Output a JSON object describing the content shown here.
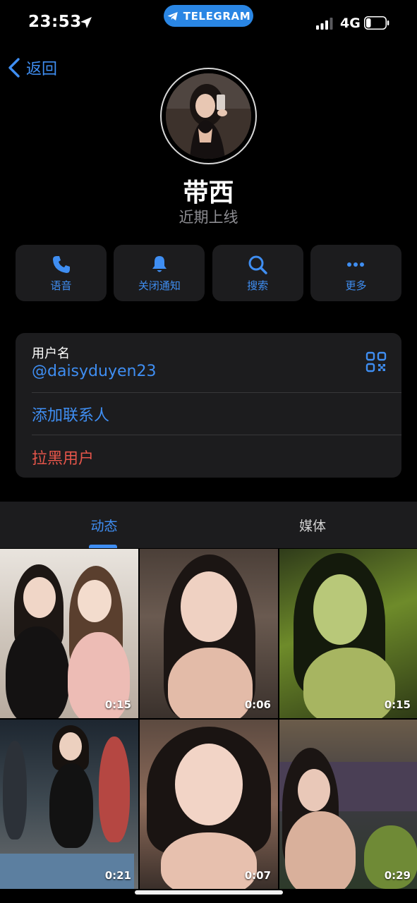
{
  "status_bar": {
    "time": "23:53",
    "telegram_pill": "TELEGRAM",
    "network": "4G",
    "battery_level": 0.25,
    "signal_bars": 3
  },
  "nav": {
    "back_label": "返回"
  },
  "profile": {
    "name": "带西",
    "status": "近期上线"
  },
  "actions": [
    {
      "label": "语音",
      "icon": "phone-icon"
    },
    {
      "label": "关闭通知",
      "icon": "bell-icon"
    },
    {
      "label": "搜索",
      "icon": "search-icon"
    },
    {
      "label": "更多",
      "icon": "more-icon"
    }
  ],
  "info": {
    "username_label": "用户名",
    "username": "@daisyduyen23",
    "add_contact": "添加联系人",
    "block_user": "拉黑用户"
  },
  "tabs": {
    "stories": "动态",
    "media": "媒体"
  },
  "media": [
    {
      "duration": "0:15"
    },
    {
      "duration": "0:06"
    },
    {
      "duration": "0:15"
    },
    {
      "duration": "0:21"
    },
    {
      "duration": "0:07"
    },
    {
      "duration": "0:29"
    }
  ],
  "colors": {
    "accent": "#3f8ef2",
    "danger": "#e5554a",
    "card": "#1c1c1e",
    "telegram": "#2a86e4"
  }
}
